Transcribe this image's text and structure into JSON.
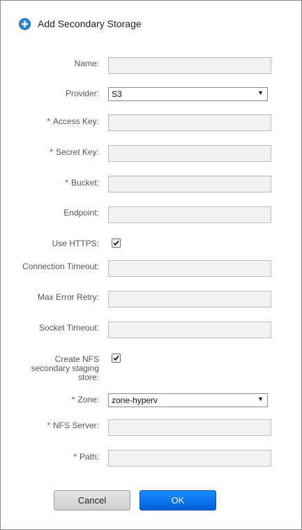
{
  "dialog": {
    "title": "Add Secondary Storage",
    "icon": "add-circle-icon"
  },
  "fields": {
    "name": {
      "label": "Name:",
      "value": ""
    },
    "provider": {
      "label": "Provider:",
      "value": "S3"
    },
    "access_key": {
      "label": "Access Key:",
      "value": "",
      "required": true
    },
    "secret_key": {
      "label": "Secret Key:",
      "value": "",
      "required": true
    },
    "bucket": {
      "label": "Bucket:",
      "value": "",
      "required": true
    },
    "endpoint": {
      "label": "Endpoint:",
      "value": ""
    },
    "use_https": {
      "label": "Use HTTPS:",
      "checked": true
    },
    "connection_timeout": {
      "label": "Connection Timeout:",
      "value": ""
    },
    "max_error_retry": {
      "label": "Max Error Retry:",
      "value": ""
    },
    "socket_timeout": {
      "label": "Socket Timeout:",
      "value": ""
    },
    "create_nfs_staging": {
      "label_lines": [
        "Create NFS",
        "secondary staging",
        "store:"
      ],
      "checked": true
    },
    "zone": {
      "label": "Zone:",
      "value": "zone-hyperv",
      "required": true
    },
    "nfs_server": {
      "label": "NFS Server:",
      "value": "",
      "required": true
    },
    "path": {
      "label": "Path:",
      "value": "",
      "required": true
    }
  },
  "required_marker": "*",
  "buttons": {
    "cancel": "Cancel",
    "ok": "OK"
  },
  "colors": {
    "required": "#cc3333",
    "primary": "#0066e0",
    "field_bg": "#f2f2f2"
  }
}
